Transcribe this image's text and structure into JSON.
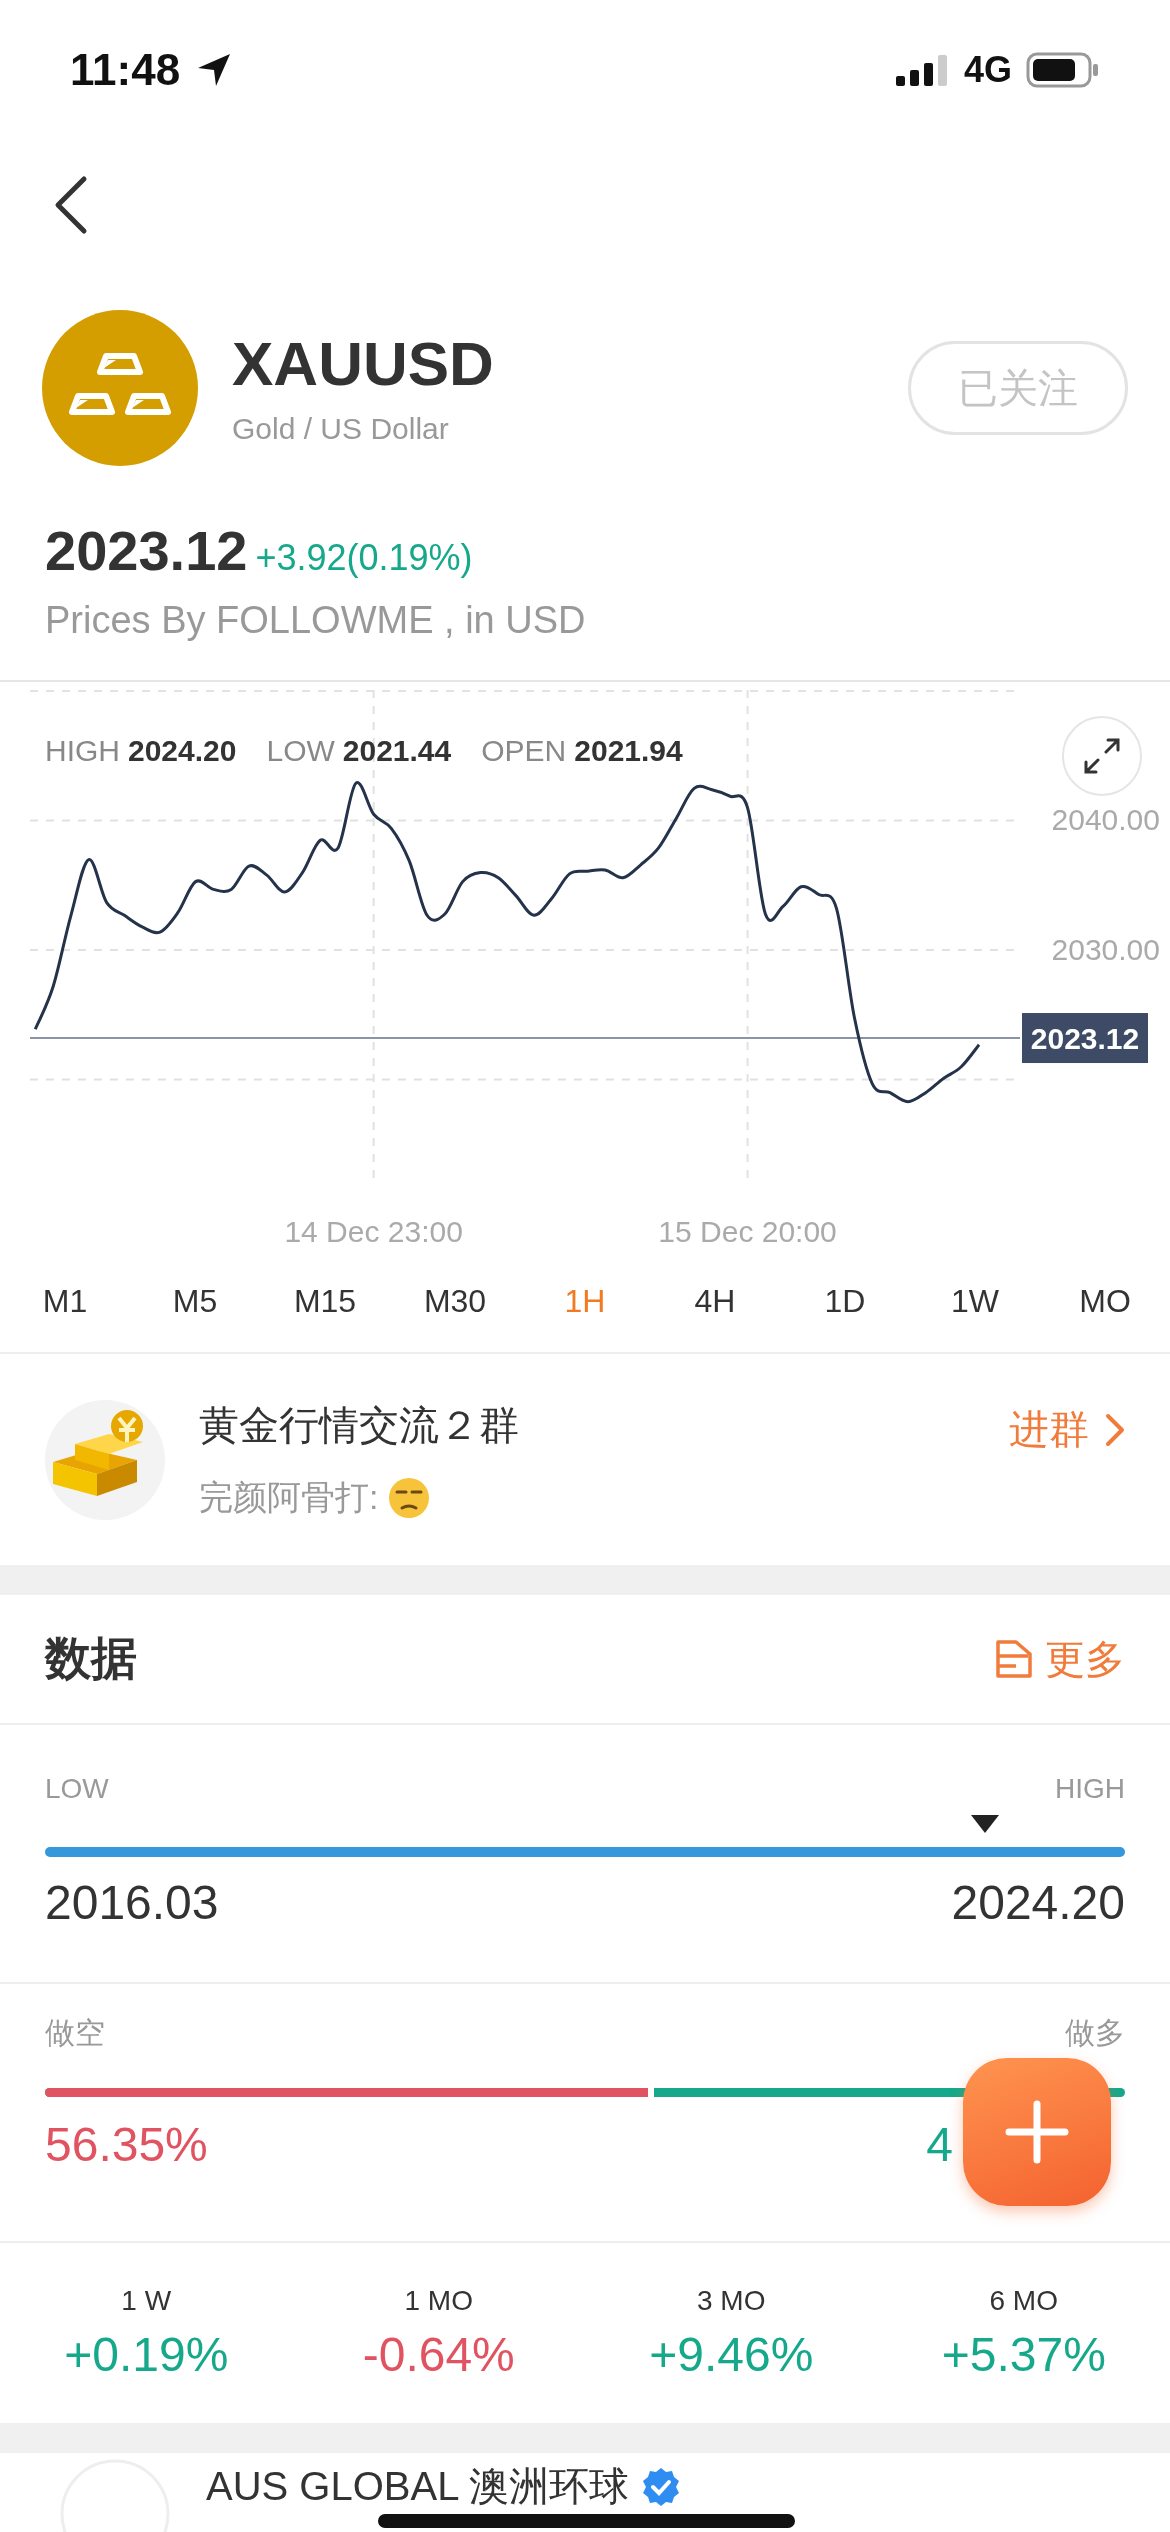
{
  "status_bar": {
    "time": "11:48",
    "network": "4G"
  },
  "header": {
    "symbol": "XAUUSD",
    "name": "Gold / US Dollar",
    "follow_button": {
      "label": "已关注",
      "followed": true
    }
  },
  "quote": {
    "price": "2023.12",
    "change": "+3.92(0.19%)",
    "source": "Prices By FOLLOWME , in USD"
  },
  "chart": {
    "stats": [
      {
        "label": "HIGH",
        "value": "2024.20"
      },
      {
        "label": "LOW",
        "value": "2021.44"
      },
      {
        "label": "OPEN",
        "value": "2021.94"
      }
    ],
    "chart_data": {
      "type": "line",
      "categories": [
        null,
        null,
        null,
        null,
        null,
        null,
        null,
        null,
        null,
        null,
        null,
        null,
        null,
        null,
        null,
        null,
        null,
        null,
        null,
        "14 Dec 23:00",
        null,
        null,
        null,
        null,
        null,
        null,
        null,
        null,
        null,
        null,
        null,
        null,
        null,
        null,
        null,
        null,
        null,
        null,
        null,
        null,
        "15 Dec 20:00",
        null,
        null,
        null,
        null,
        null,
        null,
        null,
        null,
        null,
        null,
        null,
        null,
        null
      ],
      "series": [
        {
          "color": "#24324a",
          "values": [
            2023.8,
            2027.1,
            2032.6,
            2036.9,
            2033.6,
            2032.6,
            2031.7,
            2031.3,
            2032.8,
            2035.2,
            2034.6,
            2034.6,
            2036.4,
            2035.7,
            2034.4,
            2035.9,
            2038.4,
            2037.8,
            2042.8,
            2040.4,
            2039.3,
            2036.8,
            2032.6,
            2032.7,
            2035.2,
            2035.9,
            2035.5,
            2034.1,
            2032.6,
            2033.9,
            2035.8,
            2036.0,
            2036.1,
            2035.5,
            2036.5,
            2037.8,
            2040.1,
            2042.4,
            2042.3,
            2041.8,
            2040.9,
            2032.7,
            2033.3,
            2034.8,
            2034.2,
            2033.1,
            2024.7,
            2019.6,
            2018.9,
            2018.2,
            2018.9,
            2020.0,
            2020.9,
            2022.6
          ]
        }
      ],
      "ylim": [
        2012,
        2050
      ],
      "grid": true,
      "yticks": [
        {
          "value": 2040,
          "label": "2040.00"
        },
        {
          "value": 2030,
          "label": "2030.00"
        }
      ],
      "ref_lines": [
        {
          "axis": "y",
          "value": 2023.12,
          "label": "2023.12"
        }
      ]
    }
  },
  "timeframes": [
    {
      "label": "M1",
      "selected": false
    },
    {
      "label": "M5",
      "selected": false
    },
    {
      "label": "M15",
      "selected": false
    },
    {
      "label": "M30",
      "selected": false
    },
    {
      "label": "1H",
      "selected": true
    },
    {
      "label": "4H",
      "selected": false
    },
    {
      "label": "1D",
      "selected": false
    },
    {
      "label": "1W",
      "selected": false
    },
    {
      "label": "MO",
      "selected": false
    }
  ],
  "group": {
    "title": "黄金行情交流２群",
    "last_message": "完颜阿骨打:",
    "action": "进群"
  },
  "data": {
    "title": "数据",
    "more": "更多",
    "range": {
      "low_label": "LOW",
      "high_label": "HIGH",
      "low": "2016.03",
      "high": "2024.20",
      "level": 0.87
    },
    "sentiment": {
      "short_label": "做空",
      "long_label": "做多",
      "level": 0.5635,
      "short_pct": "56.35%",
      "long_pct": "4"
    },
    "performance": [
      {
        "period": "1 W",
        "change": "+0.19%",
        "color": "#16a88a"
      },
      {
        "period": "1 MO",
        "change": "-0.64%",
        "color": "#e05462"
      },
      {
        "period": "3 MO",
        "change": "+9.46%",
        "color": "#16a88a"
      },
      {
        "period": "6 MO",
        "change": "+5.37%",
        "color": "#16a88a"
      }
    ]
  },
  "next_item": {
    "name": "AUS GLOBAL 澳洲环球",
    "verified": true
  }
}
